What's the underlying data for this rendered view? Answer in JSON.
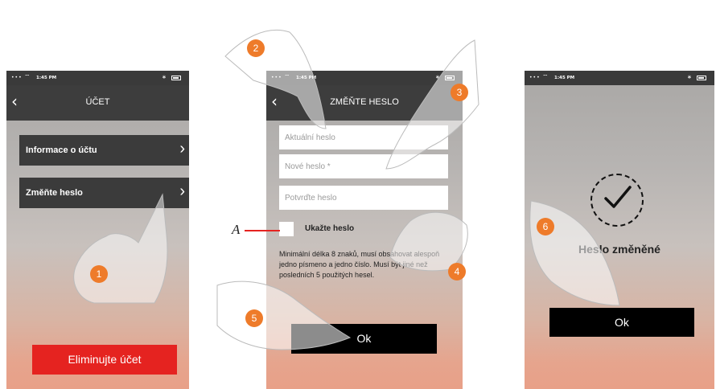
{
  "status_bar": {
    "time": "1:45 PM"
  },
  "screen1": {
    "title": "ÚČET",
    "items": [
      {
        "label": "Informace o účtu"
      },
      {
        "label": "Změňte heslo"
      }
    ],
    "delete_button": "Eliminujte účet"
  },
  "screen2": {
    "title": "ZMĚŇTE HESLO",
    "fields": [
      {
        "placeholder": "Aktuální heslo"
      },
      {
        "placeholder": "Nové heslo *"
      },
      {
        "placeholder": "Potvrďte heslo"
      }
    ],
    "show_password_label": "Ukažte heslo",
    "hint": "Minimální délka 8 znaků, musí obsahovat alespoň jedno písmeno a jedno číslo. Musí být jiné než posledních 5 použitých hesel.",
    "ok_button": "Ok"
  },
  "screen3": {
    "message": "Heslo změněné",
    "ok_button": "Ok"
  },
  "annotations": {
    "label_a": "A",
    "steps": [
      "1",
      "2",
      "3",
      "4",
      "5",
      "6"
    ],
    "badge_color": "#ee7b2a",
    "accent_red": "#e52320"
  }
}
